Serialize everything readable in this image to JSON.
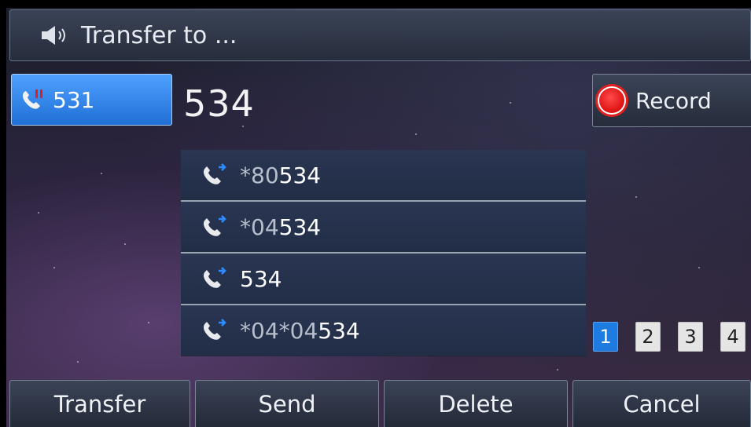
{
  "header": {
    "title": "Transfer to ...",
    "icon": "speaker-icon"
  },
  "line_key": {
    "label": "531",
    "icon": "phone-hold-icon",
    "color": "#2b82ea"
  },
  "dialed_number": "534",
  "record_button": {
    "label": "Record",
    "icon": "record-icon",
    "color": "#e01414"
  },
  "suggestions": [
    {
      "prefix": "*80",
      "match": "534",
      "icon": "phone-transfer-icon"
    },
    {
      "prefix": "*04",
      "match": "534",
      "icon": "phone-transfer-icon"
    },
    {
      "prefix": "",
      "match": "534",
      "icon": "phone-transfer-icon"
    },
    {
      "prefix": "*04*04",
      "match": "534",
      "icon": "phone-transfer-icon"
    }
  ],
  "pages": {
    "items": [
      "1",
      "2",
      "3",
      "4"
    ],
    "active": "1"
  },
  "softkeys": [
    "Transfer",
    "Send",
    "Delete",
    "Cancel"
  ]
}
